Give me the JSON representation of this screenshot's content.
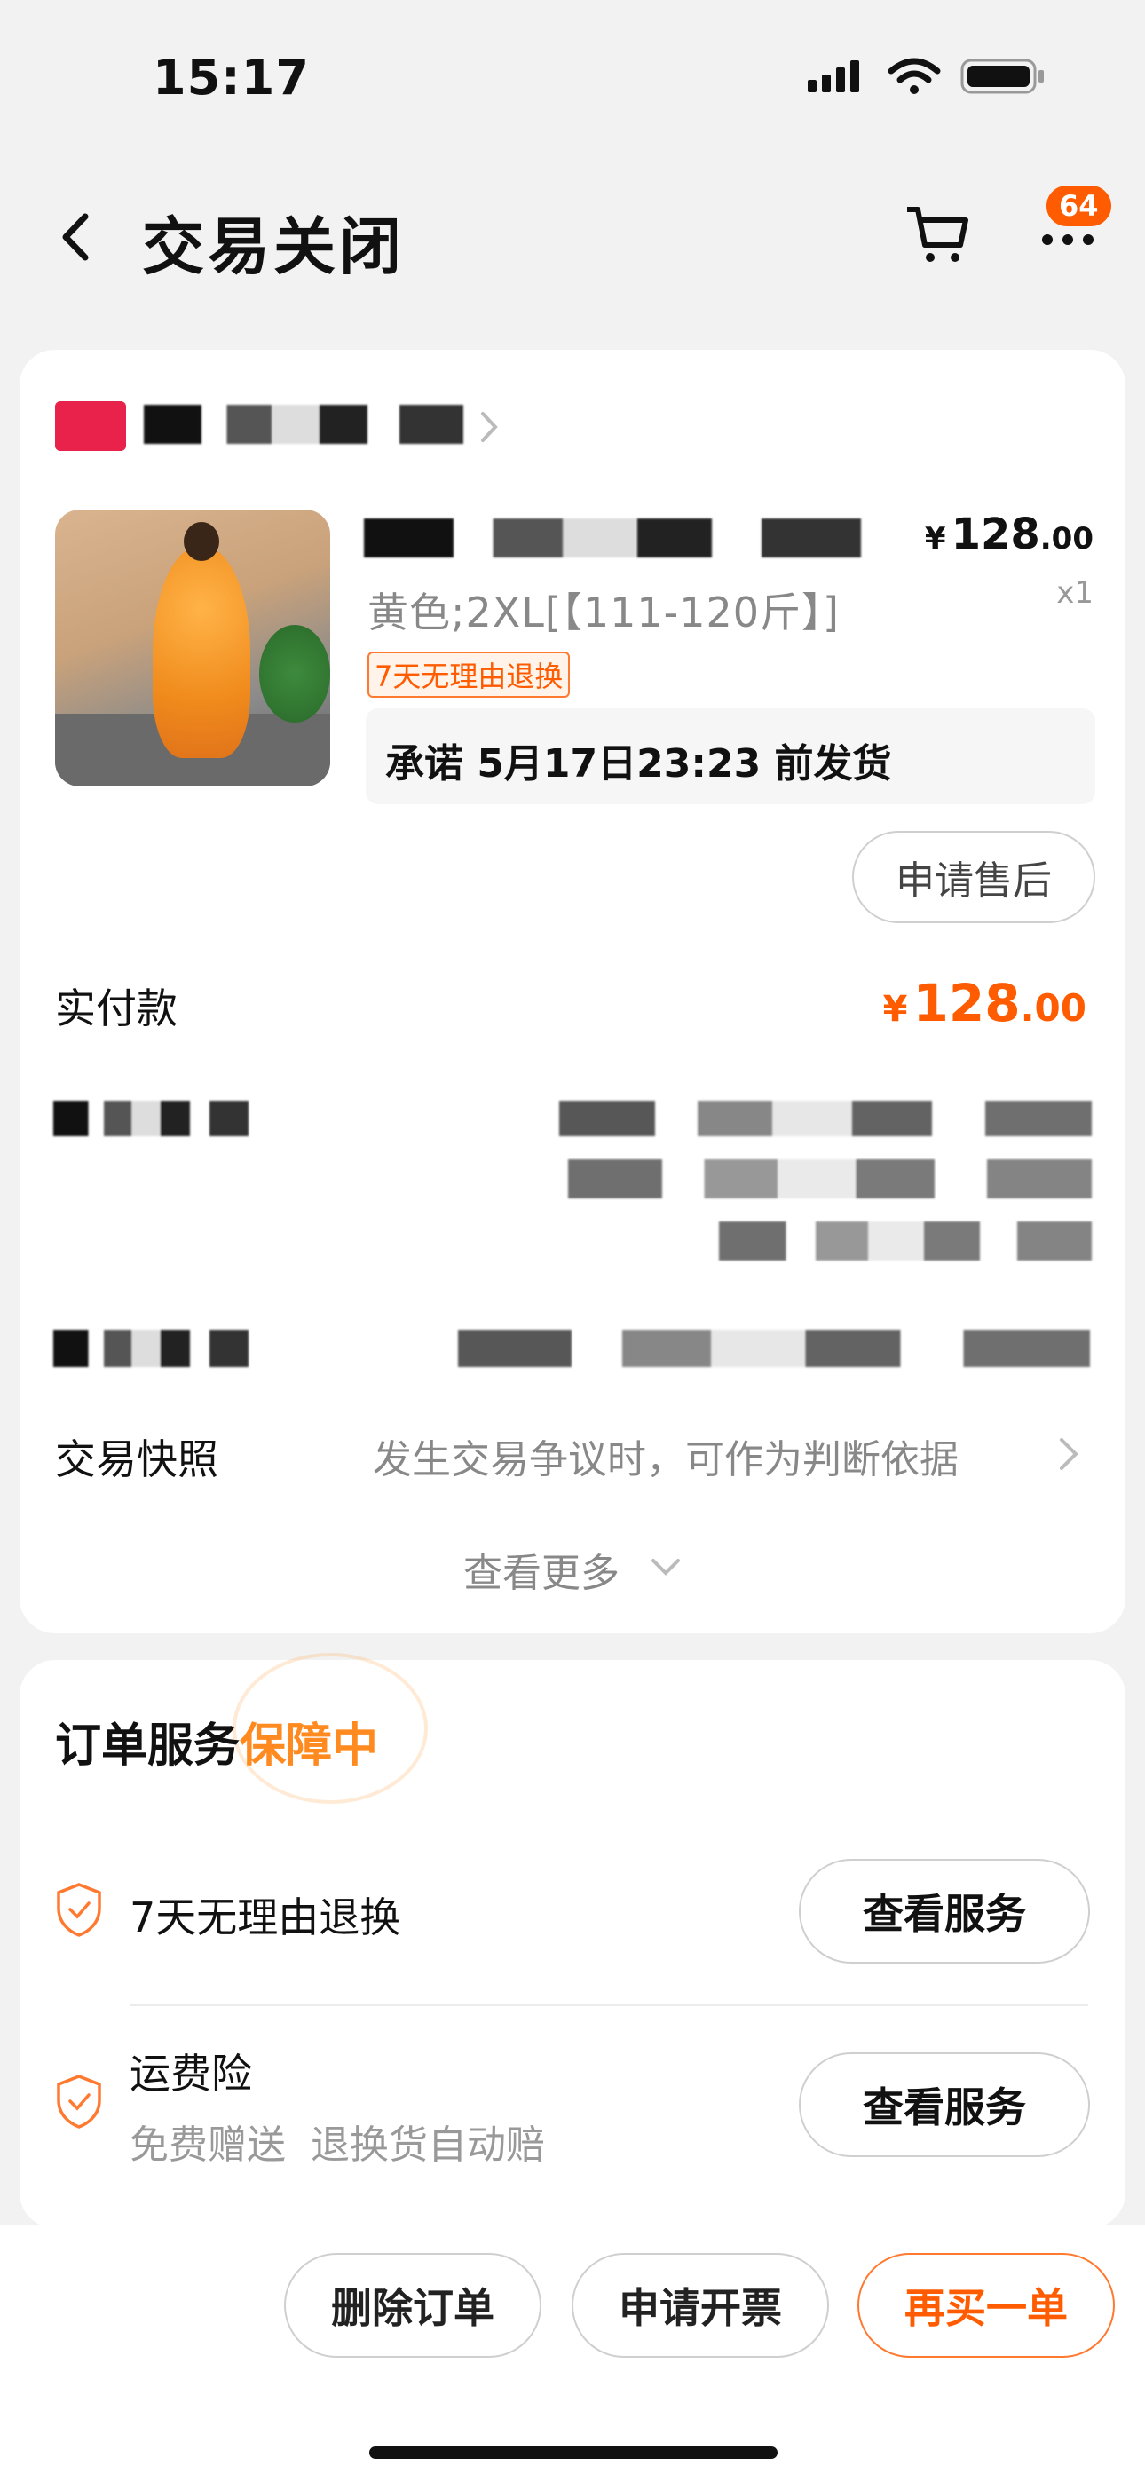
{
  "status_bar": {
    "time": "15:17"
  },
  "nav": {
    "title": "交易关闭",
    "badge": "64"
  },
  "order": {
    "sku": "黄色;2XL[【111-120斤】]",
    "return_tag": "7天无理由退换",
    "promise": "承诺 5月17日23:23 前发货",
    "price_currency": "¥",
    "price_int": "128",
    "price_dec": ".00",
    "quantity": "x1",
    "after_sale_button": "申请售后",
    "paid_label": "实付款",
    "paid_currency": "¥",
    "paid_int": "128",
    "paid_dec": ".00",
    "snapshot_label": "交易快照",
    "snapshot_desc": "发生交易争议时，可作为判断依据",
    "see_more": "查看更多"
  },
  "service": {
    "title_prefix": "订单服务",
    "title_highlight": "保障中",
    "items": [
      {
        "label": "7天无理由退换",
        "button": "查看服务"
      },
      {
        "label": "运费险",
        "sub": "免费赠送  退换货自动赔",
        "button": "查看服务"
      }
    ]
  },
  "bottom_bar": {
    "delete": "删除订单",
    "invoice": "申请开票",
    "rebuy": "再买一单"
  },
  "colors": {
    "accent": "#ff5b00",
    "highlight": "#ff8a1f"
  }
}
